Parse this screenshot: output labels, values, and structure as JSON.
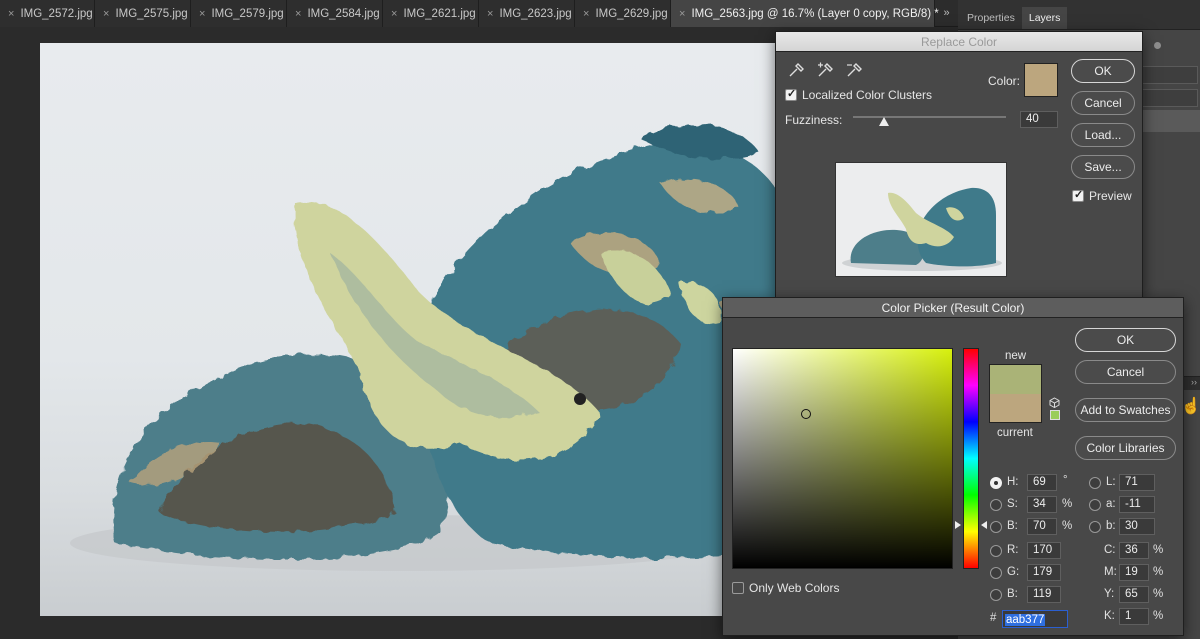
{
  "tabs": [
    {
      "label": "IMG_2572.jpg",
      "active": false
    },
    {
      "label": "IMG_2575.jpg",
      "active": false
    },
    {
      "label": "IMG_2579.jpg",
      "active": false
    },
    {
      "label": "IMG_2584.jpg",
      "active": false
    },
    {
      "label": "IMG_2621.jpg",
      "active": false
    },
    {
      "label": "IMG_2623.jpg",
      "active": false
    },
    {
      "label": "IMG_2629.jpg",
      "active": false
    },
    {
      "label": "IMG_2563.jpg @ 16.7% (Layer 0 copy, RGB/8) *",
      "active": true
    }
  ],
  "tab_close_glyph": "×",
  "tab_overflow_glyph": "»",
  "right_panel": {
    "tabs": [
      "Properties",
      "Layers"
    ],
    "active_tab": "Layers"
  },
  "replace_color": {
    "title": "Replace Color",
    "color_label": "Color:",
    "color_swatch": "#bca67e",
    "localized_label": "Localized Color Clusters",
    "localized_checked": true,
    "fuzziness_label": "Fuzziness:",
    "fuzziness_value": "40",
    "fuzziness_fraction": 0.2,
    "preview_label": "Preview",
    "preview_checked": true,
    "buttons": {
      "ok": "OK",
      "cancel": "Cancel",
      "load": "Load...",
      "save": "Save..."
    },
    "eyedroppers": [
      "eyedropper-icon",
      "eyedropper-plus-icon",
      "eyedropper-minus-icon"
    ]
  },
  "color_picker": {
    "title": "Color Picker (Result Color)",
    "new_label": "new",
    "current_label": "current",
    "new_color": "#aab377",
    "current_color": "#bca67e",
    "hue_color": "#d7f00d",
    "buttons": {
      "ok": "OK",
      "cancel": "Cancel",
      "add_swatches": "Add to Swatches",
      "color_libraries": "Color Libraries"
    },
    "only_web_colors": "Only Web Colors",
    "hsb": {
      "h": {
        "label": "H:",
        "value": "69",
        "unit": "°"
      },
      "s": {
        "label": "S:",
        "value": "34",
        "unit": "%"
      },
      "b": {
        "label": "B:",
        "value": "70",
        "unit": "%"
      }
    },
    "rgb": {
      "r": {
        "label": "R:",
        "value": "170"
      },
      "g": {
        "label": "G:",
        "value": "179"
      },
      "b": {
        "label": "B:",
        "value": "119"
      }
    },
    "lab": {
      "l": {
        "label": "L:",
        "value": "71"
      },
      "a": {
        "label": "a:",
        "value": "-11"
      },
      "b": {
        "label": "b:",
        "value": "30"
      }
    },
    "cmyk": {
      "c": {
        "label": "C:",
        "value": "36",
        "unit": "%"
      },
      "m": {
        "label": "M:",
        "value": "19",
        "unit": "%"
      },
      "y": {
        "label": "Y:",
        "value": "65",
        "unit": "%"
      },
      "k": {
        "label": "K:",
        "value": "1",
        "unit": "%"
      }
    },
    "hex_prefix": "#",
    "hex": "aab377"
  }
}
